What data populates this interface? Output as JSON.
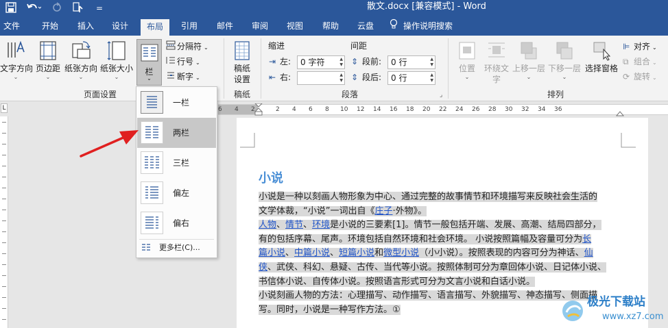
{
  "titlebar": {
    "title": "散文.docx [兼容模式]  -  Word",
    "save_icon": "save-icon",
    "undo_icon": "undo-icon",
    "redo_icon": "redo-icon",
    "touch_icon": "touch-mode-icon",
    "more": "="
  },
  "tabs": [
    "文件",
    "开始",
    "插入",
    "设计",
    "布局",
    "引用",
    "邮件",
    "审阅",
    "视图",
    "帮助",
    "云盘",
    "操作说明搜索"
  ],
  "active_tab": "布局",
  "ribbon": {
    "page_setup": {
      "label": "页面设置",
      "text_direction": "文字方向",
      "margins": "页边距",
      "orientation": "纸张方向",
      "size": "纸张大小",
      "columns": "栏",
      "breaks": "分隔符",
      "line_numbers": "行号",
      "hyphenation": "断字"
    },
    "draft": {
      "label": "稿纸",
      "draft_settings_1": "稿纸",
      "draft_settings_2": "设置"
    },
    "paragraph": {
      "label": "段落",
      "indent": "缩进",
      "spacing": "间距",
      "left_label": "左:",
      "left_value": "0 字符",
      "right_label": "右:",
      "before_label": "段前:",
      "before_value": "0 行",
      "after_label": "段后:",
      "after_value": "0 行"
    },
    "arrange": {
      "label": "排列",
      "position": "位置",
      "wrap_1": "环绕文",
      "wrap_2": "字",
      "forward": "上移一层",
      "backward": "下移一层",
      "selection_pane": "选择窗格",
      "align": "对齐",
      "group": "组合",
      "rotate": "旋转"
    }
  },
  "ruler": {
    "numbers": [
      "6",
      "4",
      "2",
      "2",
      "4",
      "6",
      "8",
      "10",
      "12",
      "14",
      "16",
      "18",
      "20",
      "22",
      "24",
      "26",
      "28",
      "30",
      "32",
      "34",
      "36"
    ]
  },
  "columns_menu": {
    "items": [
      "一栏",
      "两栏",
      "三栏",
      "偏左",
      "偏右"
    ],
    "selected": "两栏",
    "more": "更多栏(C)..."
  },
  "document": {
    "heading": "小说",
    "p1_a": "小说是一种以刻画人物形象为中心、通过完整的故事情节和环境描写来反映社会生活的",
    "p1_b1": "文学体裁，“小说”一词出自《",
    "p1_link": "庄子",
    "p1_b2": "·外物》。",
    "p2_l1_link1": "人物",
    "p2_l1_s1": "、",
    "p2_l1_link2": "情节",
    "p2_l1_s2": "、",
    "p2_l1_link3": "环境",
    "p2_l1_rest": "是小说的三要素[1]。情节一般包括开端、发展、高潮、结局四部分，",
    "p2_l2_a": "有的包括序幕、尾声。环境包括自然环境和社会环境。 小说按照篇幅及容量可分为",
    "p2_l2_link": "长",
    "p2_l3_link1": "篇小说",
    "p2_l3_s1": "、",
    "p2_l3_link2": "中篇小说",
    "p2_l3_s2": "、",
    "p2_l3_link3": "短篇小说",
    "p2_l3_s3": "和",
    "p2_l3_link4": "微型小说",
    "p2_l3_rest": "（小小说）。按照表现的内容可分为神话、",
    "p2_l3_link5": "仙",
    "p2_l4_link": "侠",
    "p2_l4_rest": "、武侠、科幻、悬疑、古传、当代等小说。按照体制可分为章回体小说、日记体小说、",
    "p2_l5": "书信体小说、自传体小说。按照语言形式可分为文言小说和白话小说。",
    "p3_l1": "小说刻画人物的方法：心理描写、动作描写、语言描写、外貌描写、神态描写、侧面描",
    "p3_l2": "写。同时，小说是一种写作方法。①"
  },
  "watermark": {
    "title": "极光下载站",
    "url": "www.xz7.com"
  },
  "colors": {
    "accent": "#2b579a",
    "heading": "#4a8fd6",
    "link": "#2054c8",
    "arrow": "#e02020"
  }
}
